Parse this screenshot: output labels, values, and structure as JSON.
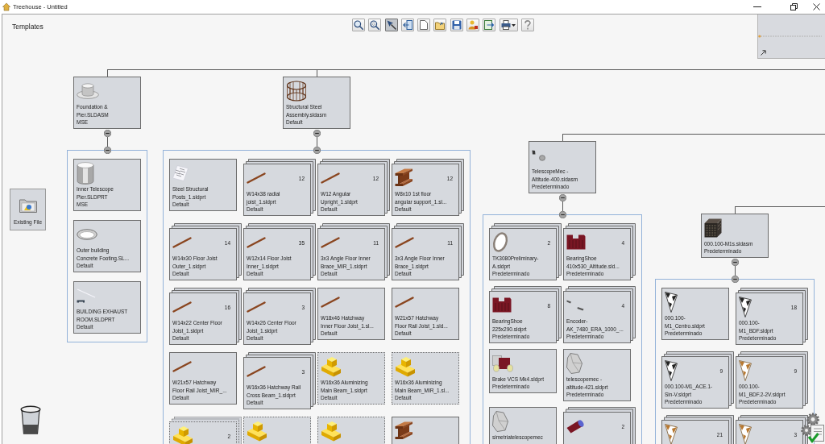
{
  "window": {
    "title": "Treehouse - Untitled"
  },
  "panel": {
    "title": "Templates"
  },
  "toolbar": [
    {
      "kind": "find",
      "pressed": false
    },
    {
      "kind": "zoom",
      "pressed": false
    },
    {
      "kind": "pin",
      "pressed": true
    },
    {
      "kind": "import",
      "pressed": false
    },
    {
      "kind": "new",
      "pressed": false
    },
    {
      "kind": "open",
      "pressed": false
    },
    {
      "kind": "save",
      "pressed": false
    },
    {
      "kind": "properties",
      "pressed": false
    },
    {
      "kind": "export",
      "pressed": false
    },
    {
      "kind": "print",
      "pressed": false
    },
    {
      "kind": "help",
      "pressed": false
    }
  ],
  "palette": {
    "existing_file": "Existing File"
  },
  "tree": [
    {
      "name": "Foundation &\nPier.SLDASM",
      "config": "MSE",
      "kind": "pier",
      "expanded": true,
      "children": [
        {
          "name": "Inner Telescope\nPier.SLDPRT",
          "config": "MSE",
          "kind": "cylinder",
          "stacked": false,
          "dotted": false
        },
        {
          "name": "Outer building\nConcrete Footing.SL...",
          "config": "Default",
          "kind": "footing",
          "stacked": false,
          "dotted": false
        },
        {
          "name": "BUILDING EXHAUST\nROOM.SLDPRT",
          "config": "Default",
          "kind": "strut",
          "stacked": false,
          "dotted": false
        }
      ]
    },
    {
      "name": "Structural Steel\nAssembly.sldasm",
      "config": "Default",
      "kind": "cage",
      "expanded": true,
      "children": [
        {
          "name": "Steel Structural\nPosts_1.sldprt",
          "config": "Default",
          "kind": "posts",
          "stacked": false,
          "dotted": false
        },
        {
          "name": "W14x38 radial\njoist_1.sldprt",
          "config": "Default",
          "count": "12",
          "kind": "rod",
          "stacked": true,
          "dotted": false
        },
        {
          "name": "W12 Angular\nUpright_1.sldprt",
          "config": "Default",
          "count": "12",
          "kind": "rod",
          "stacked": true,
          "dotted": false
        },
        {
          "name": "W8x10 1st floor\nangular support_1.sl...",
          "config": "Default",
          "count": "12",
          "kind": "girder",
          "stacked": true,
          "dotted": false
        },
        {
          "name": "W14x30 Floor Joist\nOuter_1.sldprt",
          "config": "Default",
          "count": "14",
          "kind": "rod",
          "stacked": true,
          "dotted": false
        },
        {
          "name": "W12x14 Floor Joist\nInner_1.sldprt",
          "config": "Default",
          "count": "35",
          "kind": "rod",
          "stacked": true,
          "dotted": false
        },
        {
          "name": "3x3 Angle Floor Inner\nBrace_MIR_1.sldprt",
          "config": "Default",
          "count": "11",
          "kind": "rod",
          "stacked": true,
          "dotted": false
        },
        {
          "name": "3x3 Angle Floor Inner\nBrace_1.sldprt",
          "config": "Default",
          "count": "11",
          "kind": "rod",
          "stacked": true,
          "dotted": false
        },
        {
          "name": "W14x22 Center Floor\nJoist_1.sldprt",
          "config": "Default",
          "count": "16",
          "kind": "rod",
          "stacked": true,
          "dotted": false
        },
        {
          "name": "W14x26 Center Floor\nJoist_1.sldprt",
          "config": "Default",
          "count": "3",
          "kind": "rod",
          "stacked": true,
          "dotted": false
        },
        {
          "name": "W18x46 Hatchway\nInner Floor Joist_1.sl...",
          "config": "Default",
          "kind": "rod",
          "stacked": false,
          "dotted": false
        },
        {
          "name": "W21x57 Hatchway\nFloor Rail Joist_1.sld...",
          "config": "Default",
          "kind": "rod",
          "stacked": false,
          "dotted": false
        },
        {
          "name": "W21x57 Hatchway\nFloor Rail Joist_MIR_...",
          "config": "Default",
          "kind": "rod",
          "stacked": false,
          "dotted": false
        },
        {
          "name": "W16x36 Hatchway Rail\nCross Beam_1.sldprt",
          "config": "Default",
          "count": "3",
          "kind": "rod",
          "stacked": true,
          "dotted": false
        },
        {
          "name": "W16x36 Aluminizing\nMain Beam_1.sldprt",
          "config": "Default",
          "kind": "block",
          "stacked": false,
          "dotted": true
        },
        {
          "name": "W16x36 Aluminizing\nMain Beam_MIR_1.sl...",
          "config": "Default",
          "kind": "block",
          "stacked": false,
          "dotted": true
        },
        {
          "count": "2",
          "kind": "block",
          "stacked": true,
          "dotted": true
        },
        {
          "kind": "block",
          "stacked": false,
          "dotted": true
        },
        {
          "kind": "block",
          "stacked": false,
          "dotted": true
        },
        {
          "kind": "girder",
          "stacked": false,
          "dotted": false
        }
      ]
    },
    {
      "name": "TelescopeMec -\nAltitude-400.sldasm",
      "config": "Predeterminado",
      "kind": "parts",
      "expanded": true,
      "children": [
        {
          "name": "TK3080Preliminary-\nA.sldprt",
          "config": "Predeterminado",
          "count": "2",
          "kind": "ring",
          "stacked": true,
          "dotted": false
        },
        {
          "name": "BearingShoe\n410x530_Altitude.sld...",
          "config": "Predeterminado",
          "count": "4",
          "kind": "shoe",
          "stacked": true,
          "dotted": false
        },
        {
          "name": "BearingShoe\n225x290.sldprt",
          "config": "Predeterminado",
          "count": "8",
          "kind": "shoe",
          "stacked": true,
          "dotted": false
        },
        {
          "name": "Encoder-\nAK_7480_ERA_1000_...",
          "config": "Predeterminado",
          "count": "4",
          "kind": "sensor",
          "stacked": true,
          "dotted": false
        },
        {
          "name": "Brake VCS Mk4.sldprt",
          "config": "Predeterminado",
          "kind": "brake",
          "stacked": false,
          "dotted": false
        },
        {
          "name": "telescopemec -\naltitude-421.sldprt",
          "config": "Predeterminado",
          "kind": "housing",
          "stacked": false,
          "dotted": false
        },
        {
          "name": "simetriatelescopemec",
          "kind": "housing",
          "stacked": false,
          "dotted": false
        },
        {
          "count": "2",
          "kind": "plug",
          "stacked": true,
          "dotted": false
        }
      ]
    },
    {
      "name": "000.100-M1s.sldasm",
      "config": "Predeterminado",
      "kind": "lattice",
      "expanded": true,
      "children": [
        {
          "name": "000.100-\nM1_Centro.sldprt",
          "config": "Predeterminado",
          "kind": "mirror",
          "stacked": false,
          "dotted": false
        },
        {
          "name": "000.100-\nM1_BDF.sldprt",
          "config": "Predeterminado",
          "count": "18",
          "kind": "mirror",
          "stacked": true,
          "dotted": false
        },
        {
          "name": "000.100-M1_ACE.1-\nSin-V.sldprt",
          "config": "Predeterminado",
          "count": "9",
          "kind": "mirror",
          "stacked": true,
          "dotted": false
        },
        {
          "name": "000.100-\nM1_BDF.2-2V.sldprt",
          "config": "Predeterminado",
          "count": "9",
          "kind": "segment",
          "stacked": true,
          "dotted": false
        },
        {
          "count": "21",
          "kind": "segment",
          "stacked": true,
          "dotted": false
        },
        {
          "count": "3",
          "kind": "segment",
          "stacked": true,
          "dotted": false
        }
      ]
    }
  ]
}
